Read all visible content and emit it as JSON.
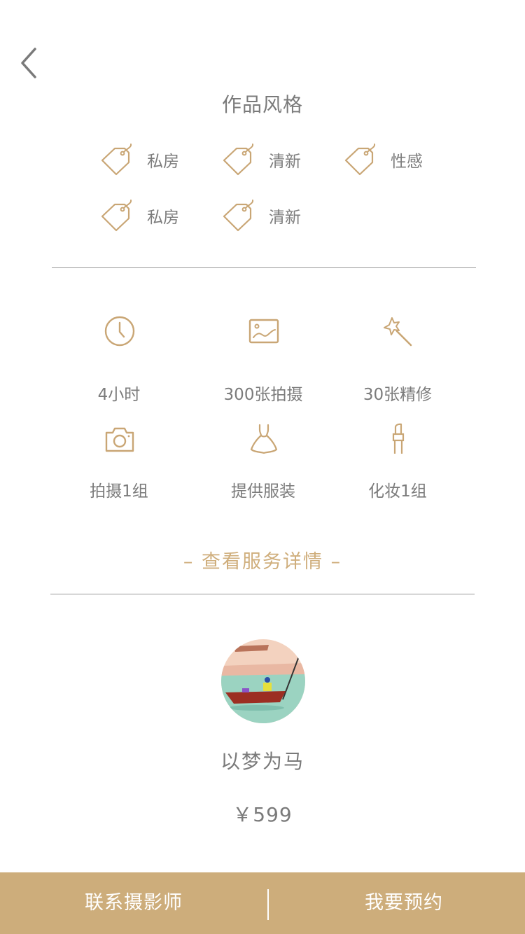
{
  "nav": {
    "back_icon": "chevron-left-icon"
  },
  "styles": {
    "title": "作品风格",
    "tags": [
      {
        "label": "私房",
        "icon": "tag-icon"
      },
      {
        "label": "清新",
        "icon": "tag-icon"
      },
      {
        "label": "性感",
        "icon": "tag-icon"
      },
      {
        "label": "私房",
        "icon": "tag-icon"
      },
      {
        "label": "清新",
        "icon": "tag-icon"
      }
    ]
  },
  "features": [
    {
      "label": "4小时",
      "icon": "clock-icon"
    },
    {
      "label": "300张拍摄",
      "icon": "picture-icon"
    },
    {
      "label": "30张精修",
      "icon": "magic-wand-icon"
    },
    {
      "label": "拍摄1组",
      "icon": "camera-icon"
    },
    {
      "label": "提供服装",
      "icon": "dress-icon"
    },
    {
      "label": "化妆1组",
      "icon": "lipstick-icon"
    }
  ],
  "details_link": "– 查看服务详情 –",
  "photographer": {
    "name": "以梦为马",
    "price": "￥599"
  },
  "bottom_bar": {
    "contact_label": "联系摄影师",
    "book_label": "我要预约"
  },
  "colors": {
    "accent": "#cdad7b",
    "icon": "#c9a675",
    "text": "#7a7a7a"
  }
}
